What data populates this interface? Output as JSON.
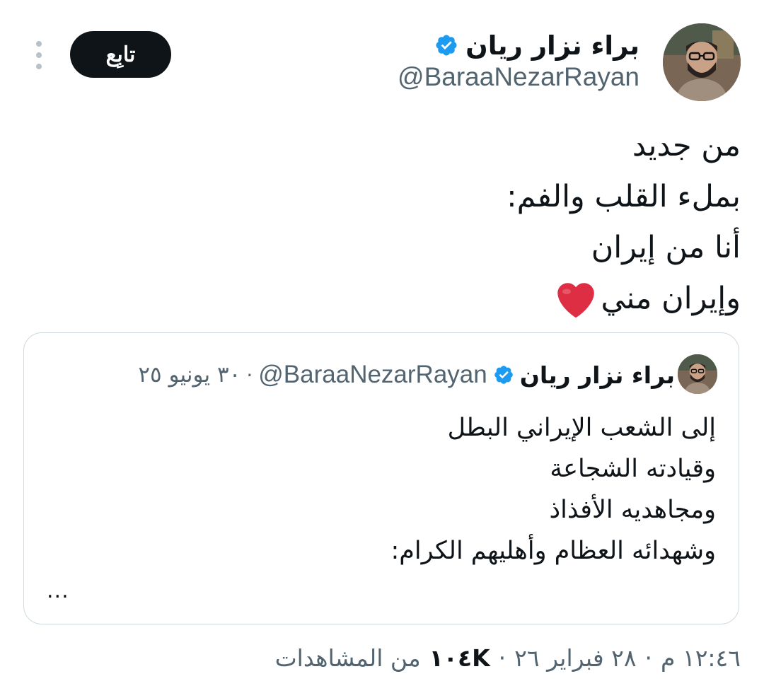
{
  "tweet": {
    "author": {
      "name": "براء نزار ريان",
      "handle": "@BaraaNezarRayan",
      "verified": true,
      "avatar_icon": "profile-photo"
    },
    "follow_label": "تابِع",
    "more_icon": "more-vertical-icon",
    "text_lines": [
      "من جديد",
      "بملء القلب والفم:",
      "أنا من إيران",
      "وإيران مني"
    ],
    "emoji": "red-heart",
    "quoted": {
      "author": {
        "name": "براء نزار ريان",
        "handle": "@BaraaNezarRayan",
        "verified": true
      },
      "separator": "·",
      "date": "٣٠ يونيو ٢٥",
      "text_lines": [
        "إلى الشعب الإيراني البطل",
        "وقيادته الشجاعة",
        "ومجاهديه الأفذاذ",
        "وشهدائه العظام وأهليهم الكرام:"
      ],
      "more": "..."
    },
    "meta": {
      "time": "١٢:٤٦ م",
      "separator": "·",
      "date": "٢٨ فبراير ٢٦",
      "views": "١٠٤K",
      "views_label": "من المشاهدات"
    }
  },
  "colors": {
    "text": "#0f1419",
    "secondary": "#536471",
    "verified": "#1d9bf0",
    "border": "#cfd9de",
    "button_bg": "#0f1419",
    "button_text": "#ffffff",
    "heart": "#e0245e"
  }
}
